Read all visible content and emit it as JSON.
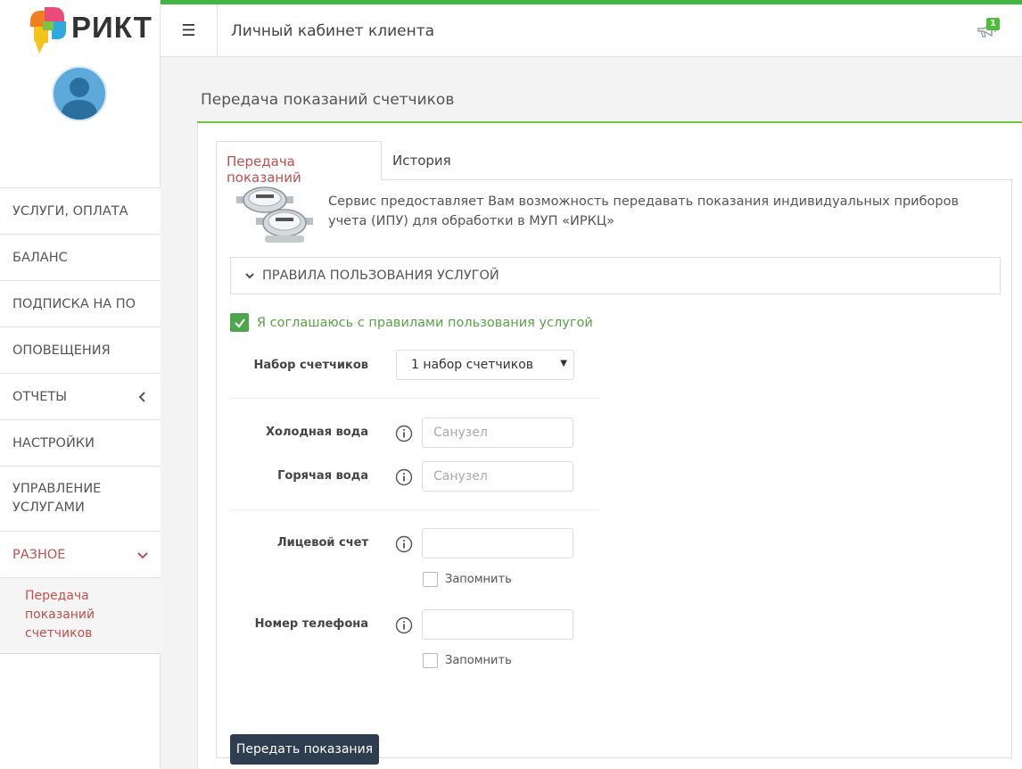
{
  "logo": {
    "text": "РИКТ"
  },
  "sidebar": {
    "items": [
      {
        "label": "УСЛУГИ, ОПЛАТА"
      },
      {
        "label": "БАЛАНС"
      },
      {
        "label": "ПОДПИСКА НА ПО"
      },
      {
        "label": "ОПОВЕЩЕНИЯ"
      },
      {
        "label": "ОТЧЕТЫ"
      },
      {
        "label": "НАСТРОЙКИ"
      },
      {
        "label": "УПРАВЛЕНИЕ УСЛУГАМИ"
      },
      {
        "label": "РАЗНОЕ"
      }
    ],
    "subitem": "Передача показаний счетчиков"
  },
  "topbar": {
    "title": "Личный кабинет клиента",
    "notification_count": "1"
  },
  "page": {
    "title": "Передача показаний счетчиков"
  },
  "tabs": {
    "active": "Передача показаний",
    "history": "История"
  },
  "form": {
    "description": "Сервис предоставляет Вам возможность передавать показания индивидуальных приборов учета (ИПУ) для обработки в МУП «ИРКЦ»",
    "rules_label": "ПРАВИЛА ПОЛЬЗОВАНИЯ УСЛУГОЙ",
    "agree_label": "Я соглашаюсь с правилами пользования услугой",
    "meter_set_label": "Набор счетчиков",
    "meter_set_value": "1 набор счетчиков",
    "cold_water_label": "Холодная вода",
    "cold_water_placeholder": "Санузел",
    "hot_water_label": "Горячая вода",
    "hot_water_placeholder": "Санузел",
    "account_label": "Лицевой счет",
    "phone_label": "Номер телефона",
    "remember_label": "Запомнить",
    "submit_label": "Передать показания"
  },
  "colors": {
    "accent_green": "#43b543",
    "active_red": "#c0504d",
    "button_dark": "#2e3e50"
  }
}
